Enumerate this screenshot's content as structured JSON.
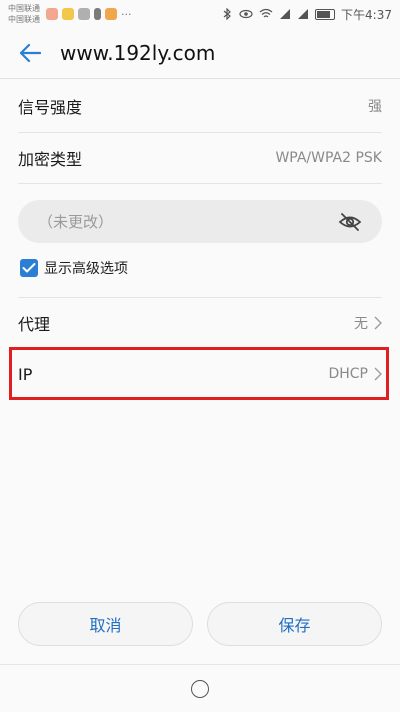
{
  "status": {
    "carriers": [
      "中国联通",
      "中国联通"
    ],
    "time": "下午4:37"
  },
  "header": {
    "title": "www.192ly.com"
  },
  "rows": {
    "signal": {
      "label": "信号强度",
      "value": "强"
    },
    "security": {
      "label": "加密类型",
      "value": "WPA/WPA2 PSK"
    },
    "proxy": {
      "label": "代理",
      "value": "无"
    },
    "ip": {
      "label": "IP",
      "value": "DHCP"
    }
  },
  "password": {
    "placeholder": "（未更改）"
  },
  "advanced": {
    "label": "显示高级选项",
    "checked": true
  },
  "buttons": {
    "cancel": "取消",
    "save": "保存"
  },
  "colors": {
    "accent": "#2a7fd4",
    "highlight": "#e02020"
  }
}
